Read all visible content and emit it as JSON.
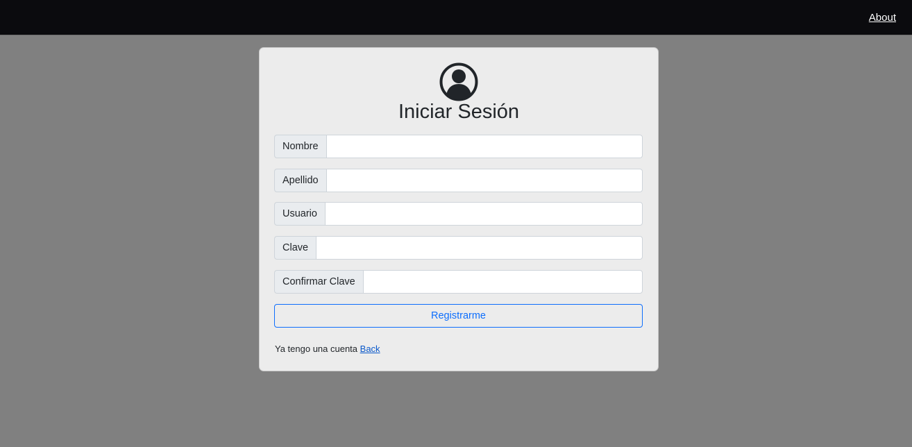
{
  "nav": {
    "about_label": "About"
  },
  "form": {
    "title": "Iniciar Sesión",
    "avatar_icon": "user-circle-icon",
    "fields": [
      {
        "label": "Nombre",
        "value": "",
        "placeholder": ""
      },
      {
        "label": "Apellido",
        "value": "",
        "placeholder": ""
      },
      {
        "label": "Usuario",
        "value": "",
        "placeholder": ""
      },
      {
        "label": "Clave",
        "value": "",
        "placeholder": ""
      },
      {
        "label": "Confirmar Clave",
        "value": "",
        "placeholder": ""
      }
    ],
    "submit_label": "Registrarme",
    "footer_text": "Ya tengo una cuenta",
    "footer_link": "Back"
  },
  "colors": {
    "page_background": "#808080",
    "topbar_background": "#0b0b0e",
    "card_background": "#ececec",
    "primary": "#0d6efd"
  }
}
